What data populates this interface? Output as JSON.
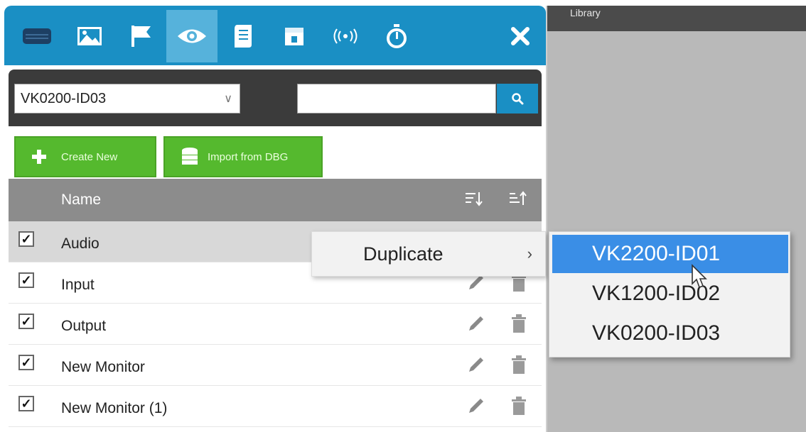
{
  "toolbar": {
    "items": [
      {
        "icon": "device-icon"
      },
      {
        "icon": "image-icon"
      },
      {
        "icon": "flag-icon"
      },
      {
        "icon": "eye-icon",
        "active": true
      },
      {
        "icon": "script-icon"
      },
      {
        "icon": "calendar-icon"
      },
      {
        "icon": "broadcast-icon"
      },
      {
        "icon": "timer-icon"
      }
    ],
    "close_icon": "close-icon",
    "accent": "#1a8fc4",
    "active_color": "#56b2db"
  },
  "library": {
    "title": "Library"
  },
  "filter": {
    "device_select_value": "VK0200-ID03",
    "search_value": ""
  },
  "actions": {
    "create_label": "Create New",
    "import_label": "Import from DBG",
    "button_color": "#55b92e"
  },
  "table": {
    "header_name": "Name",
    "rows": [
      {
        "checked": true,
        "name": "Audio",
        "highlighted": true
      },
      {
        "checked": true,
        "name": "Input"
      },
      {
        "checked": true,
        "name": "Output"
      },
      {
        "checked": true,
        "name": "New Monitor"
      },
      {
        "checked": true,
        "name": "New Monitor (1)"
      }
    ]
  },
  "context_menu": {
    "label": "Duplicate",
    "arrow": "›",
    "submenu": [
      {
        "label": "VK2200-ID01",
        "selected": true
      },
      {
        "label": "VK1200-ID02"
      },
      {
        "label": "VK0200-ID03"
      }
    ],
    "selected_color": "#3a8ee6"
  }
}
